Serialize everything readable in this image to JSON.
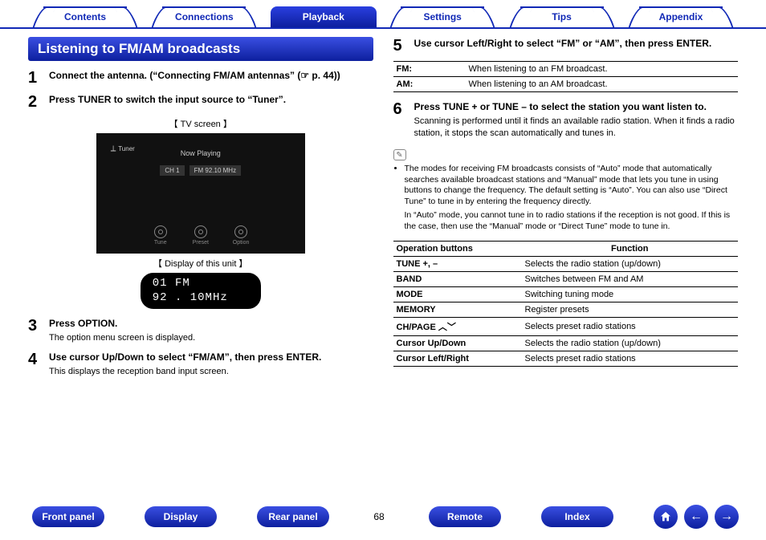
{
  "tabs": {
    "contents": "Contents",
    "connections": "Connections",
    "playback": "Playback",
    "settings": "Settings",
    "tips": "Tips",
    "appendix": "Appendix"
  },
  "section_title": "Listening to FM/AM broadcasts",
  "steps": {
    "s1": {
      "n": "1",
      "title": "Connect the antenna. (“Connecting FM/AM antennas” (☞ p. 44))"
    },
    "s2": {
      "n": "2",
      "title": "Press TUNER to switch the input source to “Tuner”."
    },
    "s3": {
      "n": "3",
      "title": "Press OPTION.",
      "sub": "The option menu screen is displayed."
    },
    "s4": {
      "n": "4",
      "title": "Use cursor Up/Down to select “FM/AM”, then press ENTER.",
      "sub": "This displays the reception band input screen."
    },
    "s5": {
      "n": "5",
      "title": "Use cursor Left/Right to select “FM” or “AM”, then press ENTER."
    },
    "s6": {
      "n": "6",
      "title": "Press TUNE + or TUNE – to select the station you want listen to.",
      "sub": "Scanning is performed until it finds an available radio station. When it finds a radio station, it stops the scan automatically and tunes in."
    }
  },
  "labels": {
    "tv": "TV screen",
    "disp": "Display of this unit"
  },
  "tv": {
    "tuner": "Tuner",
    "now": "Now Playing",
    "ch": "CH 1",
    "freq": "FM 92.10 MHz",
    "ic1": "Tune",
    "ic2": "Preset",
    "ic3": "Option"
  },
  "disp": {
    "l1": "01   FM",
    "l2": "92 . 10MHz"
  },
  "band_table": {
    "r1a": "FM:",
    "r1b": "When listening to an FM broadcast.",
    "r2a": "AM:",
    "r2b": "When listening to an AM broadcast."
  },
  "notes": {
    "bullet": "The modes for receiving FM broadcasts consists of “Auto” mode that automatically searches available broadcast stations and “Manual” mode that lets you tune in using buttons to change the frequency. The default setting is “Auto”. You can also use “Direct Tune” to tune in by entering the frequency directly.",
    "line2": "In “Auto” mode, you cannot tune in to radio stations if the reception is not good. If this is the case, then use the “Manual” mode or “Direct Tune” mode to tune in."
  },
  "ops_table": {
    "h1": "Operation buttons",
    "h2": "Function",
    "rows": [
      {
        "a": "TUNE +, –",
        "b": "Selects the radio station (up/down)"
      },
      {
        "a": "BAND",
        "b": "Switches between FM and AM"
      },
      {
        "a": "MODE",
        "b": "Switching tuning mode"
      },
      {
        "a": "MEMORY",
        "b": "Register presets"
      },
      {
        "a": "CH/PAGE ︿﹀",
        "b": "Selects preset radio stations"
      },
      {
        "a": "Cursor Up/Down",
        "b": "Selects the radio station (up/down)"
      },
      {
        "a": "Cursor Left/Right",
        "b": "Selects preset radio stations"
      }
    ]
  },
  "footer": {
    "front": "Front panel",
    "display": "Display",
    "rear": "Rear panel",
    "page": "68",
    "remote": "Remote",
    "index": "Index"
  }
}
